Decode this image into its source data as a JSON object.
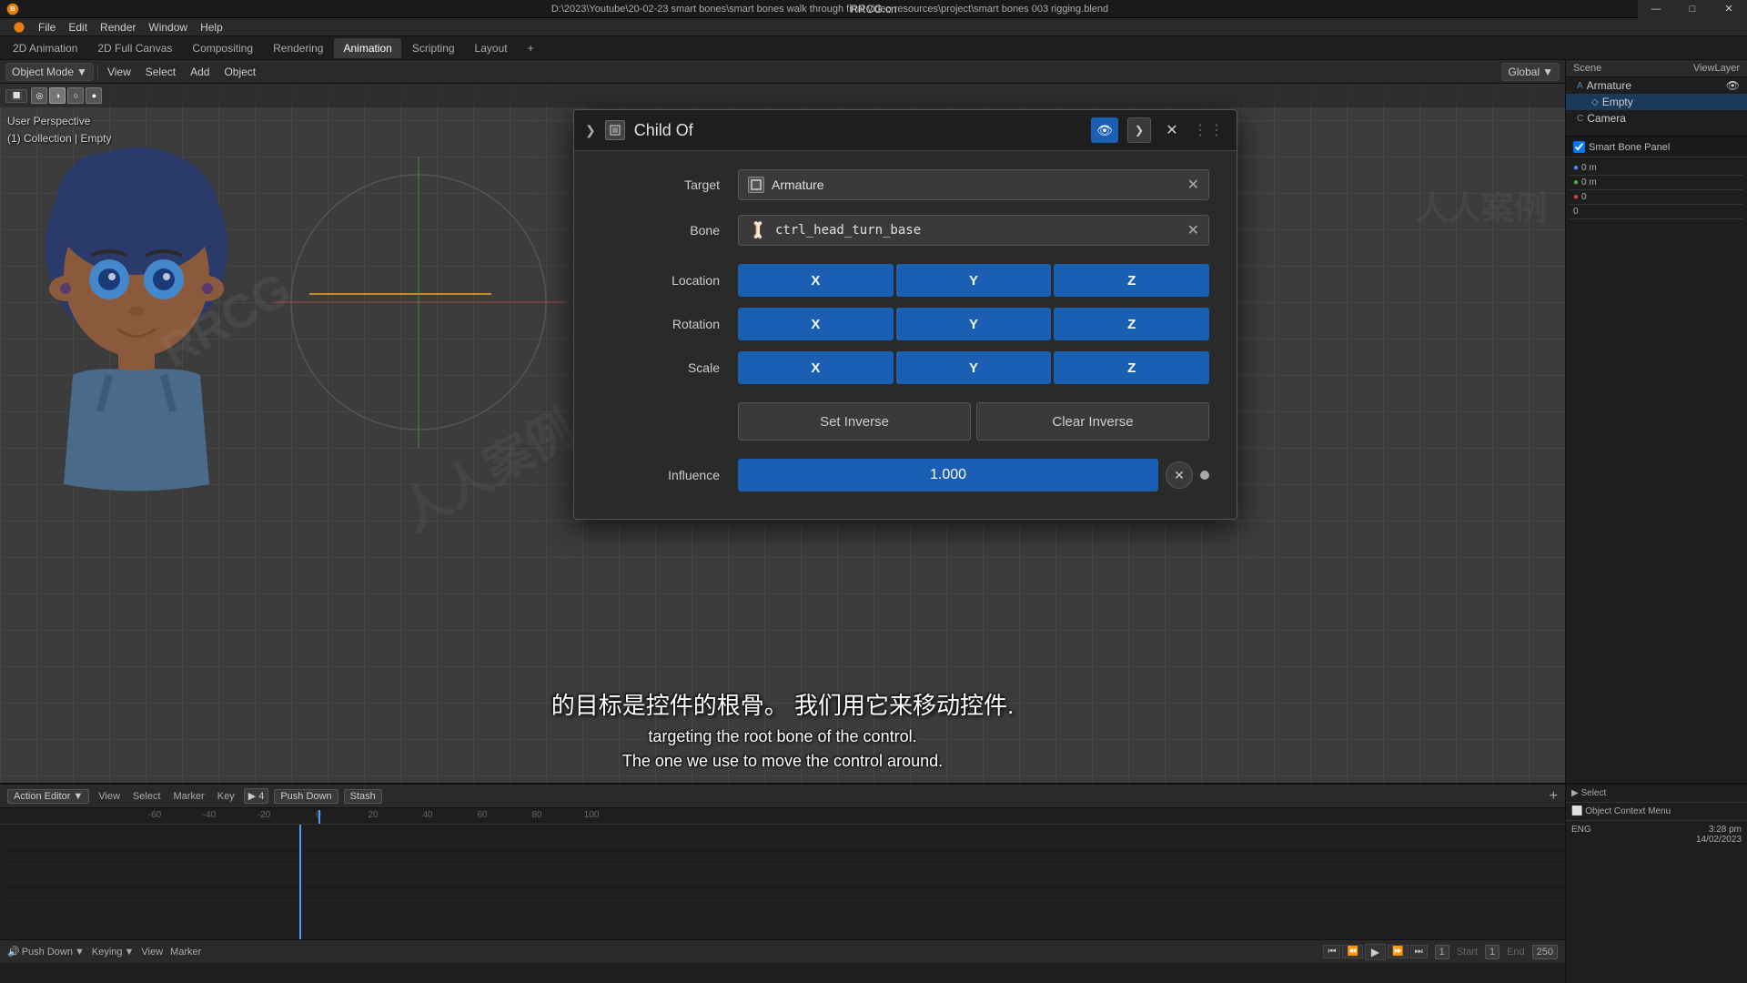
{
  "window": {
    "title": "D:\\2023\\Youtube\\20-02-23 smart bones\\smart bones walk through final video resources\\project\\smart bones 003 rigging.blend",
    "app_name": "Blender",
    "controls": {
      "minimize": "—",
      "maximize": "□",
      "close": "✕"
    },
    "title_bar": "RRCG.cn"
  },
  "menu": {
    "items": [
      "Blender",
      "File",
      "Edit",
      "Render",
      "Window",
      "Help"
    ]
  },
  "workspace_tabs": {
    "tabs": [
      "2D Animation",
      "2D Full Canvas",
      "Compositing",
      "Rendering",
      "Animation",
      "Scripting",
      "Layout",
      "+"
    ],
    "active": "Animation"
  },
  "toolbar": {
    "mode": "Object Mode",
    "items": [
      "View",
      "Select",
      "Add",
      "Object"
    ],
    "global": "Global"
  },
  "viewport": {
    "info_line1": "User Perspective",
    "info_line2": "(1) Collection | Empty"
  },
  "constraint_panel": {
    "title": "Child Of",
    "header_chevron": "❯",
    "header_icon": "⊞",
    "eye_icon": "👁",
    "dropdown_icon": "❯",
    "close_icon": "✕",
    "dots": "⋮⋮",
    "target": {
      "label": "Target",
      "icon": "□",
      "value": "Armature",
      "clear": "✕"
    },
    "bone": {
      "label": "Bone",
      "bone_icon": "🦴",
      "value": "ctrl_head_turn_base",
      "clear": "✕"
    },
    "location": {
      "label": "Location",
      "x": "X",
      "y": "Y",
      "z": "Z"
    },
    "rotation": {
      "label": "Rotation",
      "x": "X",
      "y": "Y",
      "z": "Z"
    },
    "scale": {
      "label": "Scale",
      "x": "X",
      "y": "Y",
      "z": "Z"
    },
    "set_inverse": "Set Inverse",
    "clear_inverse": "Clear Inverse",
    "influence": {
      "label": "Influence",
      "value": "1.000",
      "clear": "✕",
      "dot": "•"
    }
  },
  "right_panel": {
    "header": "Scene",
    "header2": "ViewLayer",
    "items": [
      {
        "name": "Armature",
        "icon": "A",
        "indent": false
      },
      {
        "name": "Empty",
        "icon": "E",
        "indent": true
      },
      {
        "name": "Camera",
        "icon": "C",
        "indent": false
      }
    ],
    "smart_bone_label": "Smart Bone Panel"
  },
  "timeline": {
    "editor": "Action Editor",
    "controls": [
      "Push Down",
      "Stash"
    ],
    "numbers": [
      "-60",
      "-40",
      "-20",
      "0",
      "20",
      "40",
      "60",
      "80",
      "100"
    ],
    "start": "1",
    "end": "250",
    "current": "1",
    "date": "14/02/2023",
    "time": "3:28 pm"
  },
  "subtitles": {
    "cn": "的目标是控件的根骨。  我们用它来移动控件.",
    "en_line1": "targeting the root bone of the control.",
    "en_line2": "The one we use to move the control around."
  },
  "colors": {
    "active_blue": "#1a5fb4",
    "panel_bg": "#2a2a2a",
    "darker_bg": "#1e1e1e",
    "text_main": "#e0e0e0",
    "text_dim": "#aaa",
    "border": "#555",
    "xyz_blue": "#1a5fb4"
  }
}
